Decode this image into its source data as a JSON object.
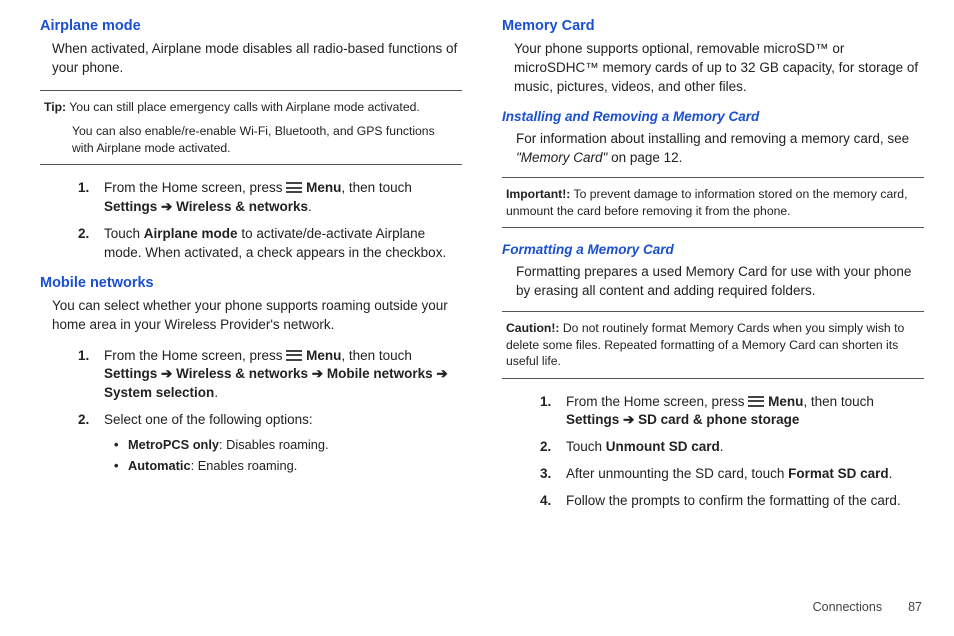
{
  "left": {
    "airplane": {
      "heading": "Airplane mode",
      "intro": "When activated, Airplane mode disables all radio-based functions of your phone.",
      "tip_label": "Tip:",
      "tip_text": " You can still place emergency calls with Airplane mode activated.",
      "tip_extra": "You can also enable/re-enable Wi-Fi, Bluetooth, and GPS functions with Airplane mode activated.",
      "step1_pre": "From the Home screen, press ",
      "step1_menu": "Menu",
      "step1_mid": ", then touch ",
      "step1_path_a": "Settings",
      "step1_arrow": " ➔ ",
      "step1_path_b": "Wireless & networks",
      "step1_end": ".",
      "step2_a": "Touch ",
      "step2_b": "Airplane mode",
      "step2_c": " to activate/de-activate Airplane mode. When activated, a check appears in the checkbox."
    },
    "mobile": {
      "heading": "Mobile networks",
      "intro": "You can select whether your phone supports roaming outside your home area in your Wireless Provider's network.",
      "step1_pre": "From the Home screen, press ",
      "step1_menu": "Menu",
      "step1_mid": ", then touch ",
      "p1": "Settings",
      "arrow": " ➔ ",
      "p2": "Wireless & networks",
      "p3": "Mobile networks",
      "p4": "System selection",
      "step1_end": ".",
      "step2": "Select one of the following options:",
      "opt1_b": "MetroPCS only",
      "opt1_t": ": Disables roaming.",
      "opt2_b": "Automatic",
      "opt2_t": ": Enables roaming."
    }
  },
  "right": {
    "memory": {
      "heading": "Memory Card",
      "intro": "Your phone supports optional, removable microSD™ or microSDHC™ memory cards of up to 32 GB capacity, for storage of music, pictures, videos, and other files."
    },
    "install": {
      "heading": "Installing and Removing a Memory Card",
      "text_a": "For information about installing and removing a memory card, see ",
      "text_ref": "\"Memory Card\"",
      "text_b": " on page 12."
    },
    "important_label": "Important!:",
    "important_text": " To prevent damage to information stored on the memory card, unmount the card before removing it from the phone.",
    "format": {
      "heading": "Formatting a Memory Card",
      "intro": "Formatting prepares a used Memory Card for use with your phone by erasing all content and adding required folders."
    },
    "caution_label": "Caution!:",
    "caution_text": " Do not routinely format Memory Cards when you simply wish to delete some files. Repeated formatting of a Memory Card can shorten its useful life.",
    "steps": {
      "s1_pre": "From the Home screen, press ",
      "s1_menu": "Menu",
      "s1_mid": ", then touch ",
      "s1_p1": "Settings",
      "s1_arrow": " ➔ ",
      "s1_p2": "SD card & phone storage",
      "s2_a": "Touch ",
      "s2_b": "Unmount SD card",
      "s2_c": ".",
      "s3_a": "After unmounting the SD card, touch ",
      "s3_b": "Format SD card",
      "s3_c": ".",
      "s4": "Follow the prompts to confirm the formatting of the card."
    }
  },
  "footer": {
    "section": "Connections",
    "page": "87"
  }
}
